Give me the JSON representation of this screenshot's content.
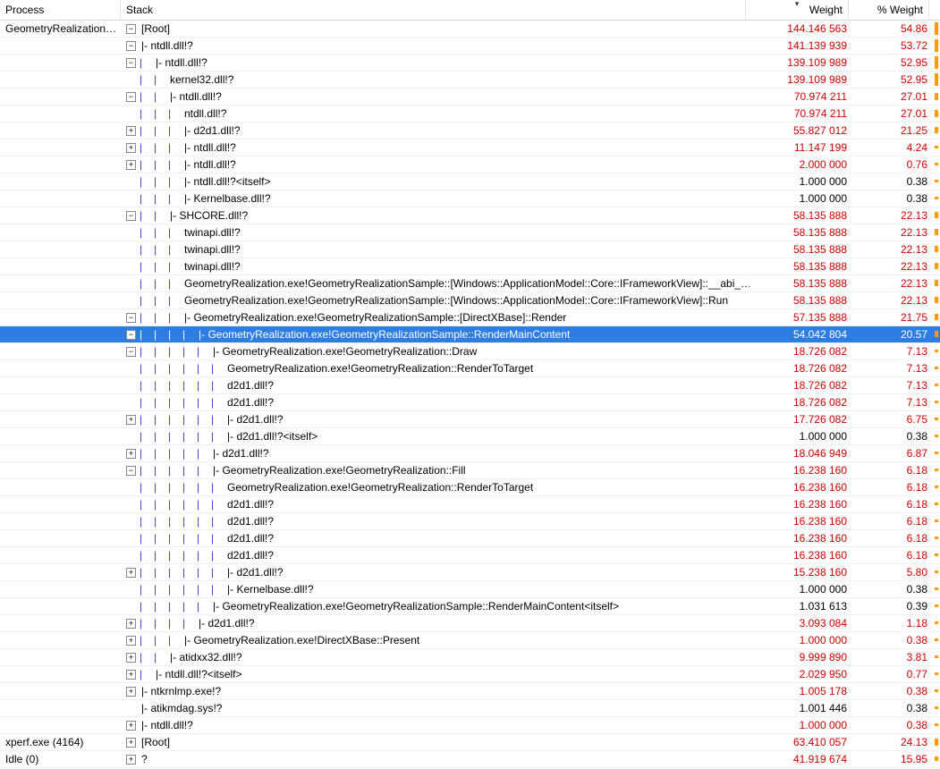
{
  "columns": {
    "process": "Process",
    "stack": "Stack",
    "weight": "Weight",
    "pweight": "% Weight"
  },
  "processes": {
    "geom": "GeometryRealization…",
    "xperf": "xperf.exe (4164)",
    "idle": "Idle (0)"
  },
  "rows": [
    {
      "proc": "geom",
      "depth": 0,
      "prefix": "",
      "exp": "minus",
      "label": "[Root]",
      "hot": true,
      "weight": "144.146 563",
      "pweight": "54.86",
      "bar": 96
    },
    {
      "proc": "",
      "depth": 0,
      "prefix": "",
      "exp": "minus",
      "label": "|- ntdll.dll!?",
      "hot": true,
      "weight": "141.139 939",
      "pweight": "53.72",
      "bar": 95
    },
    {
      "proc": "",
      "depth": 0,
      "prefix": "|",
      "exp": "minus",
      "label": "|- ntdll.dll!?",
      "hot": true,
      "weight": "139.109 989",
      "pweight": "52.95",
      "bar": 94
    },
    {
      "proc": "",
      "depth": 0,
      "prefix": "||",
      "exp": "none",
      "label": "kernel32.dll!?",
      "hot": true,
      "weight": "139.109 989",
      "pweight": "52.95",
      "bar": 94
    },
    {
      "proc": "",
      "depth": 0,
      "prefix": "||",
      "exp": "minus",
      "label": "|- ntdll.dll!?",
      "hot": true,
      "weight": "70.974 211",
      "pweight": "27.01",
      "bar": 55
    },
    {
      "proc": "",
      "depth": 0,
      "prefix": "|||",
      "exp": "none",
      "label": "ntdll.dll!?",
      "hot": true,
      "weight": "70.974 211",
      "pweight": "27.01",
      "bar": 55
    },
    {
      "proc": "",
      "depth": 0,
      "prefix": "|||",
      "exp": "plus",
      "label": "|- d2d1.dll!?",
      "hot": true,
      "weight": "55.827 012",
      "pweight": "21.25",
      "bar": 45
    },
    {
      "proc": "",
      "depth": 0,
      "prefix": "|||",
      "exp": "plus",
      "label": "|- ntdll.dll!?",
      "hot": true,
      "weight": "11.147 199",
      "pweight": "4.24",
      "bar": 16
    },
    {
      "proc": "",
      "depth": 0,
      "prefix": "|||",
      "exp": "plus",
      "label": "|- ntdll.dll!?",
      "hot": true,
      "weight": "2.000 000",
      "pweight": "0.76",
      "bar": 6
    },
    {
      "proc": "",
      "depth": 0,
      "prefix": "|||",
      "exp": "none",
      "label": "|- ntdll.dll!?<itself>",
      "hot": false,
      "weight": "1.000 000",
      "pweight": "0.38",
      "bar": 4
    },
    {
      "proc": "",
      "depth": 0,
      "prefix": "|||",
      "exp": "none",
      "label": "|- Kernelbase.dll!?",
      "hot": false,
      "weight": "1.000 000",
      "pweight": "0.38",
      "bar": 4
    },
    {
      "proc": "",
      "depth": 0,
      "prefix": "||",
      "exp": "minus",
      "label": "|- SHCORE.dll!?",
      "hot": true,
      "weight": "58.135 888",
      "pweight": "22.13",
      "bar": 48
    },
    {
      "proc": "",
      "depth": 0,
      "prefix": "|||",
      "exp": "none",
      "label": "twinapi.dll!?",
      "hot": true,
      "weight": "58.135 888",
      "pweight": "22.13",
      "bar": 48
    },
    {
      "proc": "",
      "depth": 0,
      "prefix": "|||",
      "exp": "none",
      "label": "twinapi.dll!?",
      "hot": true,
      "weight": "58.135 888",
      "pweight": "22.13",
      "bar": 48
    },
    {
      "proc": "",
      "depth": 0,
      "prefix": "|||",
      "exp": "none",
      "label": "twinapi.dll!?",
      "hot": true,
      "weight": "58.135 888",
      "pweight": "22.13",
      "bar": 48
    },
    {
      "proc": "",
      "depth": 0,
      "prefix": "|||",
      "exp": "none",
      "label": "GeometryRealization.exe!GeometryRealizationSample::[Windows::ApplicationModel::Core::IFrameworkView]::__abi_…",
      "hot": true,
      "weight": "58.135 888",
      "pweight": "22.13",
      "bar": 48
    },
    {
      "proc": "",
      "depth": 0,
      "prefix": "|||",
      "exp": "none",
      "label": "GeometryRealization.exe!GeometryRealizationSample::[Windows::ApplicationModel::Core::IFrameworkView]::Run",
      "hot": true,
      "weight": "58.135 888",
      "pweight": "22.13",
      "bar": 48
    },
    {
      "proc": "",
      "depth": 0,
      "prefix": "|||",
      "exp": "minus",
      "label": "|- GeometryRealization.exe!GeometryRealizationSample::[DirectXBase]::Render",
      "hot": true,
      "weight": "57.135 888",
      "pweight": "21.75",
      "bar": 47
    },
    {
      "proc": "",
      "depth": 0,
      "prefix": "||||",
      "exp": "minus",
      "label": "|- GeometryRealization.exe!GeometryRealizationSample::RenderMainContent",
      "hot": true,
      "weight": "54.042 804",
      "pweight": "20.57",
      "bar": 45,
      "selected": true
    },
    {
      "proc": "",
      "depth": 0,
      "prefix": "|||||",
      "exp": "minus",
      "label": "|- GeometryRealization.exe!GeometryRealization::Draw",
      "hot": true,
      "weight": "18.726 082",
      "pweight": "7.13",
      "bar": 22
    },
    {
      "proc": "",
      "depth": 0,
      "prefix": "||||||",
      "exp": "none",
      "label": "GeometryRealization.exe!GeometryRealization::RenderToTarget",
      "hot": true,
      "weight": "18.726 082",
      "pweight": "7.13",
      "bar": 22
    },
    {
      "proc": "",
      "depth": 0,
      "prefix": "||||||",
      "exp": "none",
      "label": "d2d1.dll!?",
      "hot": true,
      "weight": "18.726 082",
      "pweight": "7.13",
      "bar": 22
    },
    {
      "proc": "",
      "depth": 0,
      "prefix": "||||||",
      "exp": "none",
      "label": "d2d1.dll!?",
      "hot": true,
      "weight": "18.726 082",
      "pweight": "7.13",
      "bar": 22
    },
    {
      "proc": "",
      "depth": 0,
      "prefix": "||||||",
      "exp": "plus",
      "label": "|- d2d1.dll!?",
      "hot": true,
      "weight": "17.726 082",
      "pweight": "6.75",
      "bar": 21
    },
    {
      "proc": "",
      "depth": 0,
      "prefix": "||||||",
      "exp": "none",
      "label": "|- d2d1.dll!?<itself>",
      "hot": false,
      "weight": "1.000 000",
      "pweight": "0.38",
      "bar": 4
    },
    {
      "proc": "",
      "depth": 0,
      "prefix": "|||||",
      "exp": "plus",
      "label": "|- d2d1.dll!?",
      "hot": true,
      "weight": "18.046 949",
      "pweight": "6.87",
      "bar": 21
    },
    {
      "proc": "",
      "depth": 0,
      "prefix": "|||||",
      "exp": "minus",
      "label": "|- GeometryRealization.exe!GeometryRealization::Fill",
      "hot": true,
      "weight": "16.238 160",
      "pweight": "6.18",
      "bar": 20
    },
    {
      "proc": "",
      "depth": 0,
      "prefix": "||||||",
      "exp": "none",
      "label": "GeometryRealization.exe!GeometryRealization::RenderToTarget",
      "hot": true,
      "weight": "16.238 160",
      "pweight": "6.18",
      "bar": 20
    },
    {
      "proc": "",
      "depth": 0,
      "prefix": "||||||",
      "exp": "none",
      "label": "d2d1.dll!?",
      "hot": true,
      "weight": "16.238 160",
      "pweight": "6.18",
      "bar": 20
    },
    {
      "proc": "",
      "depth": 0,
      "prefix": "||||||",
      "exp": "none",
      "label": "d2d1.dll!?",
      "hot": true,
      "weight": "16.238 160",
      "pweight": "6.18",
      "bar": 20
    },
    {
      "proc": "",
      "depth": 0,
      "prefix": "||||||",
      "exp": "none",
      "label": "d2d1.dll!?",
      "hot": true,
      "weight": "16.238 160",
      "pweight": "6.18",
      "bar": 20
    },
    {
      "proc": "",
      "depth": 0,
      "prefix": "||||||",
      "exp": "none",
      "label": "d2d1.dll!?",
      "hot": true,
      "weight": "16.238 160",
      "pweight": "6.18",
      "bar": 20
    },
    {
      "proc": "",
      "depth": 0,
      "prefix": "||||||",
      "exp": "plus",
      "label": "|- d2d1.dll!?",
      "hot": true,
      "weight": "15.238 160",
      "pweight": "5.80",
      "bar": 19
    },
    {
      "proc": "",
      "depth": 0,
      "prefix": "||||||",
      "exp": "none",
      "label": "|- Kernelbase.dll!?",
      "hot": false,
      "weight": "1.000 000",
      "pweight": "0.38",
      "bar": 4
    },
    {
      "proc": "",
      "depth": 0,
      "prefix": "|||||",
      "exp": "none",
      "label": "|- GeometryRealization.exe!GeometryRealizationSample::RenderMainContent<itself>",
      "hot": false,
      "weight": "1.031 613",
      "pweight": "0.39",
      "bar": 4
    },
    {
      "proc": "",
      "depth": 0,
      "prefix": "||||",
      "exp": "plus",
      "label": "|- d2d1.dll!?",
      "hot": true,
      "weight": "3.093 084",
      "pweight": "1.18",
      "bar": 8
    },
    {
      "proc": "",
      "depth": 0,
      "prefix": "|||",
      "exp": "plus",
      "label": "|- GeometryRealization.exe!DirectXBase::Present",
      "hot": true,
      "weight": "1.000 000",
      "pweight": "0.38",
      "bar": 4
    },
    {
      "proc": "",
      "depth": 0,
      "prefix": "||",
      "exp": "plus",
      "label": "|- atidxx32.dll!?",
      "hot": true,
      "weight": "9.999 890",
      "pweight": "3.81",
      "bar": 14
    },
    {
      "proc": "",
      "depth": 0,
      "prefix": "|",
      "exp": "plus",
      "label": "|- ntdll.dll!?<itself>",
      "hot": true,
      "weight": "2.029 950",
      "pweight": "0.77",
      "bar": 6
    },
    {
      "proc": "",
      "depth": 0,
      "prefix": "",
      "exp": "plus",
      "label": "|- ntkrnlmp.exe!?",
      "hot": true,
      "weight": "1.005 178",
      "pweight": "0.38",
      "bar": 4
    },
    {
      "proc": "",
      "depth": 0,
      "prefix": "",
      "exp": "none",
      "label": "|- atikmdag.sys!?",
      "hot": false,
      "weight": "1.001 446",
      "pweight": "0.38",
      "bar": 4
    },
    {
      "proc": "",
      "depth": 0,
      "prefix": "",
      "exp": "plus",
      "label": "|- ntdll.dll!?",
      "hot": true,
      "weight": "1.000 000",
      "pweight": "0.38",
      "bar": 4
    },
    {
      "proc": "xperf",
      "depth": 0,
      "prefix": "",
      "exp": "plus",
      "label": "[Root]",
      "hot": true,
      "weight": "63.410 057",
      "pweight": "24.13",
      "bar": 50
    },
    {
      "proc": "idle",
      "depth": 0,
      "prefix": "",
      "exp": "plus",
      "label": "?",
      "hot": true,
      "weight": "41.919 674",
      "pweight": "15.95",
      "bar": 36
    }
  ]
}
